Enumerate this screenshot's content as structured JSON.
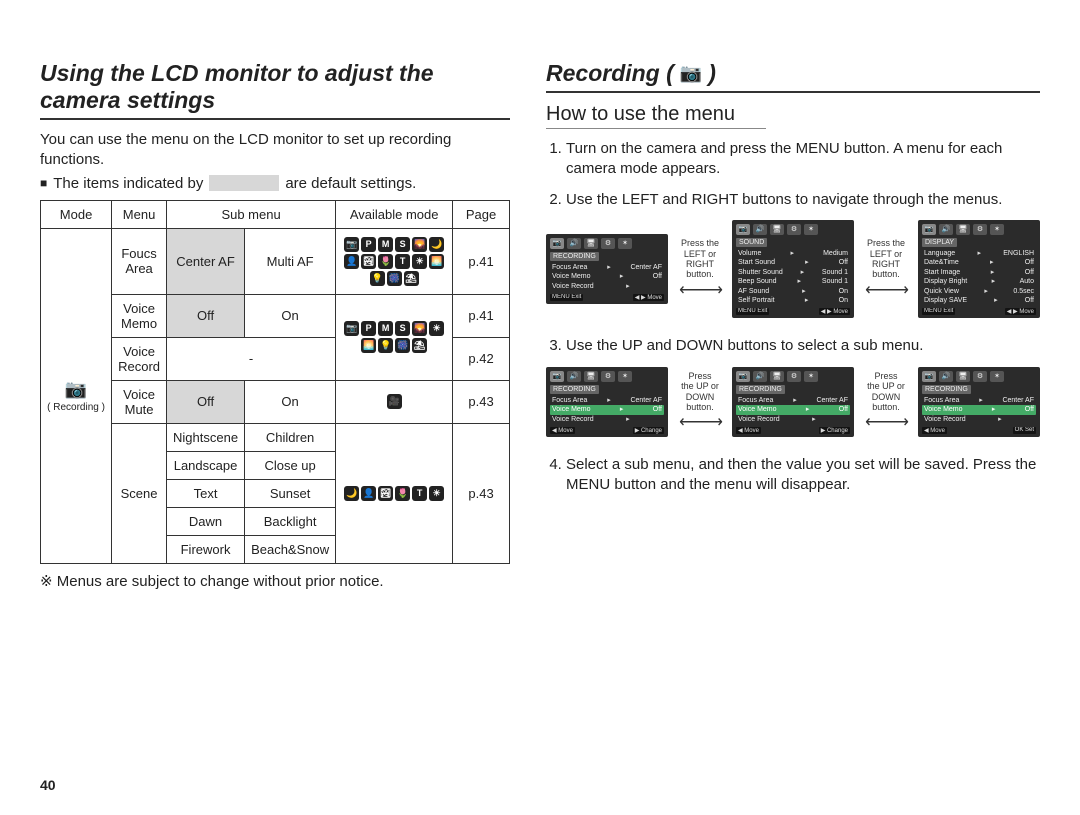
{
  "page_number": "40",
  "left": {
    "title": "Using the LCD monitor to adjust the camera settings",
    "intro": "You can use the menu on the LCD monitor to set up recording functions.",
    "default_note_pre": "The items indicated by",
    "default_note_post": "are default settings.",
    "footnote": "※ Menus are subject to change without prior notice.",
    "headers": {
      "mode": "Mode",
      "menu": "Menu",
      "submenu": "Sub menu",
      "available": "Available mode",
      "page": "Page"
    },
    "mode_label": "( Recording )",
    "rows": {
      "focus_area": {
        "menu": "Foucs Area",
        "sub1": "Center AF",
        "sub2": "Multi AF",
        "page": "p.41"
      },
      "voice_memo": {
        "menu": "Voice Memo",
        "sub1": "Off",
        "sub2": "On",
        "page": "p.41"
      },
      "voice_record": {
        "menu": "Voice Record",
        "sub_dash": "-",
        "page": "p.42"
      },
      "voice_mute": {
        "menu": "Voice Mute",
        "sub1": "Off",
        "sub2": "On",
        "page": "p.43"
      },
      "scene": {
        "menu": "Scene",
        "page": "p.43",
        "pairs": [
          [
            "Nightscene",
            "Children"
          ],
          [
            "Landscape",
            "Close up"
          ],
          [
            "Text",
            "Sunset"
          ],
          [
            "Dawn",
            "Backlight"
          ],
          [
            "Firework",
            "Beach&Snow"
          ]
        ]
      }
    },
    "mode_icons_15": [
      "📷",
      "P",
      "M",
      "S",
      "🌄",
      "🌙",
      "👤",
      "🏞",
      "🌷",
      "T",
      "☀",
      "🌅",
      "💡",
      "🎆",
      "⛱"
    ],
    "mode_icons_10": [
      "📷",
      "P",
      "M",
      "S",
      "🌄",
      "☀",
      "🌅",
      "💡",
      "🎆",
      "⛱"
    ],
    "mode_icons_6": [
      "🌙",
      "👤",
      "🏞",
      "🌷",
      "T",
      "☀"
    ],
    "mode_icons_1": [
      "🎥"
    ]
  },
  "right": {
    "title": "Recording (",
    "title_close": ")",
    "subtitle": "How to use the menu",
    "steps": [
      "Turn on the camera and press the MENU button. A menu for each camera mode appears.",
      "Use the LEFT and RIGHT buttons to navigate through the menus.",
      "Use the UP and DOWN buttons to select a sub menu.",
      "Select a sub menu, and then the value you set will be saved. Press the MENU button and the menu will disappear."
    ],
    "lcd_hint_lr": "Press the\nLEFT or\nRIGHT\nbutton.",
    "lcd_hint_ud": "Press\nthe UP or\nDOWN\nbutton.",
    "lcd": {
      "recording": {
        "title": "RECORDING",
        "rows": [
          {
            "l": "Focus Area",
            "r": "Center AF"
          },
          {
            "l": "Voice Memo",
            "r": "Off"
          },
          {
            "l": "Voice Record",
            "r": ""
          }
        ],
        "footer_l": "MENU Exit",
        "footer_r": "◀ ▶  Move"
      },
      "recording_sel2": {
        "title": "RECORDING",
        "rows": [
          {
            "l": "Focus Area",
            "r": "Center AF"
          },
          {
            "l": "Voice Memo",
            "r": "Off",
            "sel": true
          },
          {
            "l": "Voice Record",
            "r": ""
          }
        ],
        "footer_l": "◀  Move",
        "footer_r": "▶  Change"
      },
      "recording_sel2_set": {
        "title": "RECORDING",
        "rows": [
          {
            "l": "Focus Area",
            "r": "Center AF"
          },
          {
            "l": "Voice Memo",
            "r": "Off",
            "sel": true
          },
          {
            "l": "Voice Record",
            "r": ""
          }
        ],
        "footer_l": "◀  Move",
        "footer_r": "OK  Set"
      },
      "sound": {
        "title": "SOUND",
        "rows": [
          {
            "l": "Volume",
            "r": "Medium"
          },
          {
            "l": "Start Sound",
            "r": "Off"
          },
          {
            "l": "Shutter Sound",
            "r": "Sound 1"
          },
          {
            "l": "Beep Sound",
            "r": "Sound 1"
          },
          {
            "l": "AF Sound",
            "r": "On"
          },
          {
            "l": "Self Portrait",
            "r": "On"
          }
        ],
        "footer_l": "MENU Exit",
        "footer_r": "◀ ▶  Move"
      },
      "display": {
        "title": "DISPLAY",
        "rows": [
          {
            "l": "Language",
            "r": "ENGLISH"
          },
          {
            "l": "Date&Time",
            "r": "Off"
          },
          {
            "l": "Start Image",
            "r": "Off"
          },
          {
            "l": "Display Bright",
            "r": "Auto"
          },
          {
            "l": "Quick View",
            "r": "0.5sec"
          },
          {
            "l": "Display SAVE",
            "r": "Off"
          }
        ],
        "footer_l": "MENU Exit",
        "footer_r": "◀ ▶  Move"
      }
    }
  }
}
